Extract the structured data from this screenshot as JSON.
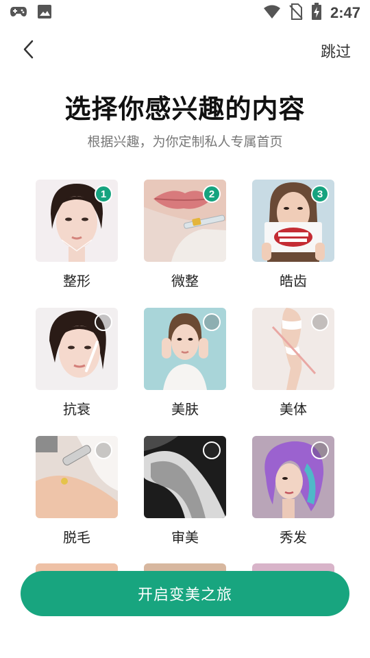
{
  "status_bar": {
    "time": "2:47",
    "left_icons": [
      "game-controller-icon",
      "image-icon"
    ],
    "right_icons": [
      "wifi-icon",
      "no-sim-icon",
      "battery-charging-icon"
    ]
  },
  "header": {
    "back_icon": "chevron-left-icon",
    "skip_label": "跳过"
  },
  "main": {
    "title": "选择你感兴趣的内容",
    "subtitle": "根据兴趣，为你定制私人专属首页"
  },
  "categories": [
    {
      "label": "整形",
      "selected": true,
      "order": "1"
    },
    {
      "label": "微整",
      "selected": true,
      "order": "2"
    },
    {
      "label": "皓齿",
      "selected": true,
      "order": "3"
    },
    {
      "label": "抗衰",
      "selected": false
    },
    {
      "label": "美肤",
      "selected": false
    },
    {
      "label": "美体",
      "selected": false
    },
    {
      "label": "脱毛",
      "selected": false
    },
    {
      "label": "审美",
      "selected": false
    },
    {
      "label": "秀发",
      "selected": false
    }
  ],
  "cta": {
    "label": "开启变美之旅"
  },
  "colors": {
    "accent": "#18a57f",
    "badge": "#16a37f",
    "title": "#111111",
    "subtitle": "#777777"
  }
}
